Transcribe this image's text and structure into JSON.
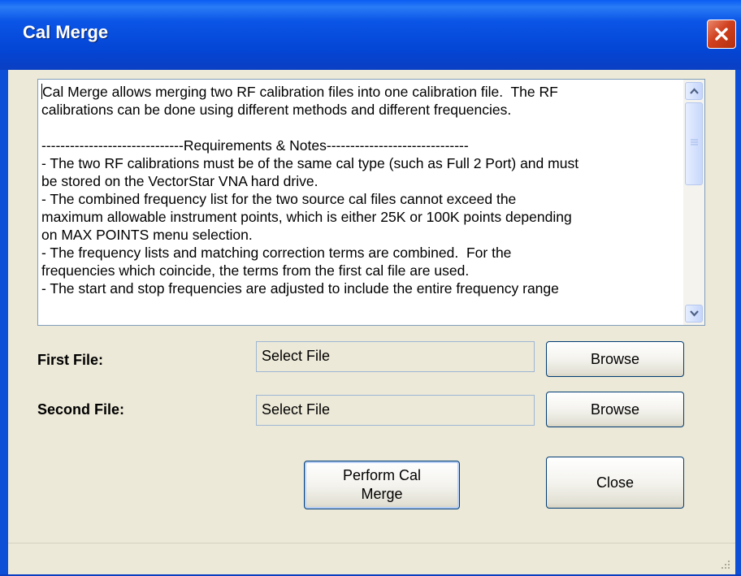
{
  "window": {
    "title": "Cal Merge"
  },
  "notes": {
    "text": "Cal Merge allows merging two RF calibration files into one calibration file.  The RF\ncalibrations can be done using different methods and different frequencies.\n\n------------------------------Requirements & Notes------------------------------\n- The two RF calibrations must be of the same cal type (such as Full 2 Port) and must\nbe stored on the VectorStar VNA hard drive.\n- The combined frequency list for the two source cal files cannot exceed the\nmaximum allowable instrument points, which is either 25K or 100K points depending\non MAX POINTS menu selection.\n- The frequency lists and matching correction terms are combined.  For the\nfrequencies which coincide, the terms from the first cal file are used.\n- The start and stop frequencies are adjusted to include the entire frequency range"
  },
  "first_file": {
    "label": "First File:",
    "value": "Select File",
    "browse_label": "Browse"
  },
  "second_file": {
    "label": "Second File:",
    "value": "Select File",
    "browse_label": "Browse"
  },
  "actions": {
    "perform_label": "Perform Cal Merge",
    "close_label": "Close"
  },
  "icons": {
    "close": "close-x-icon",
    "scroll_up": "chevron-up-icon",
    "scroll_down": "chevron-down-icon",
    "grip": "resize-grip-icon"
  },
  "colors": {
    "titlebar": "#0446d6",
    "client": "#ece9d8",
    "close_button": "#d0401e"
  }
}
